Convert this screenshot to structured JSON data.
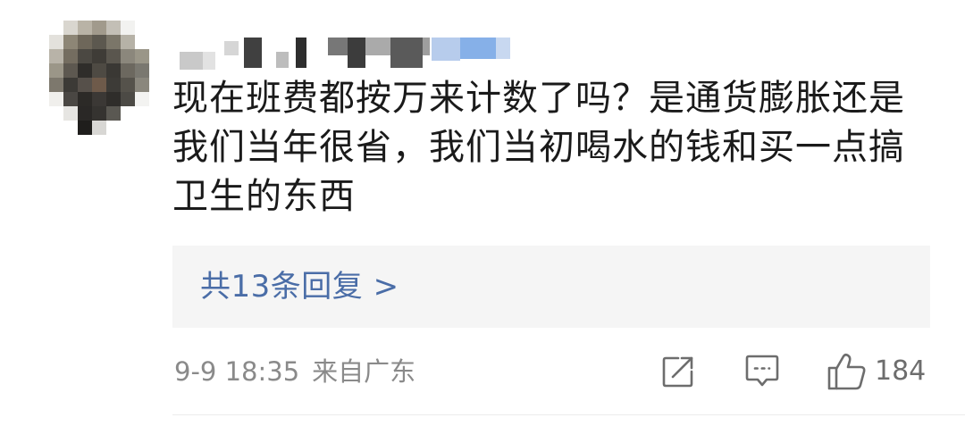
{
  "comment": {
    "text": "现在班费都按万来计数了吗？是通货膨胀还是我们当年很省，我们当初喝水的钱和买一点搞卫生的东西",
    "replies_label": "共13条回复 >",
    "date": "9-9 18:35",
    "location": "来自广东",
    "like_count": "184"
  },
  "icons": {
    "share": "share-icon",
    "reply": "comment-icon",
    "like": "thumbs-up-icon"
  },
  "colors": {
    "text": "#1a1a1a",
    "link": "#4a6da7",
    "meta": "#8a8a8a",
    "reply_bg": "#f5f5f5"
  }
}
